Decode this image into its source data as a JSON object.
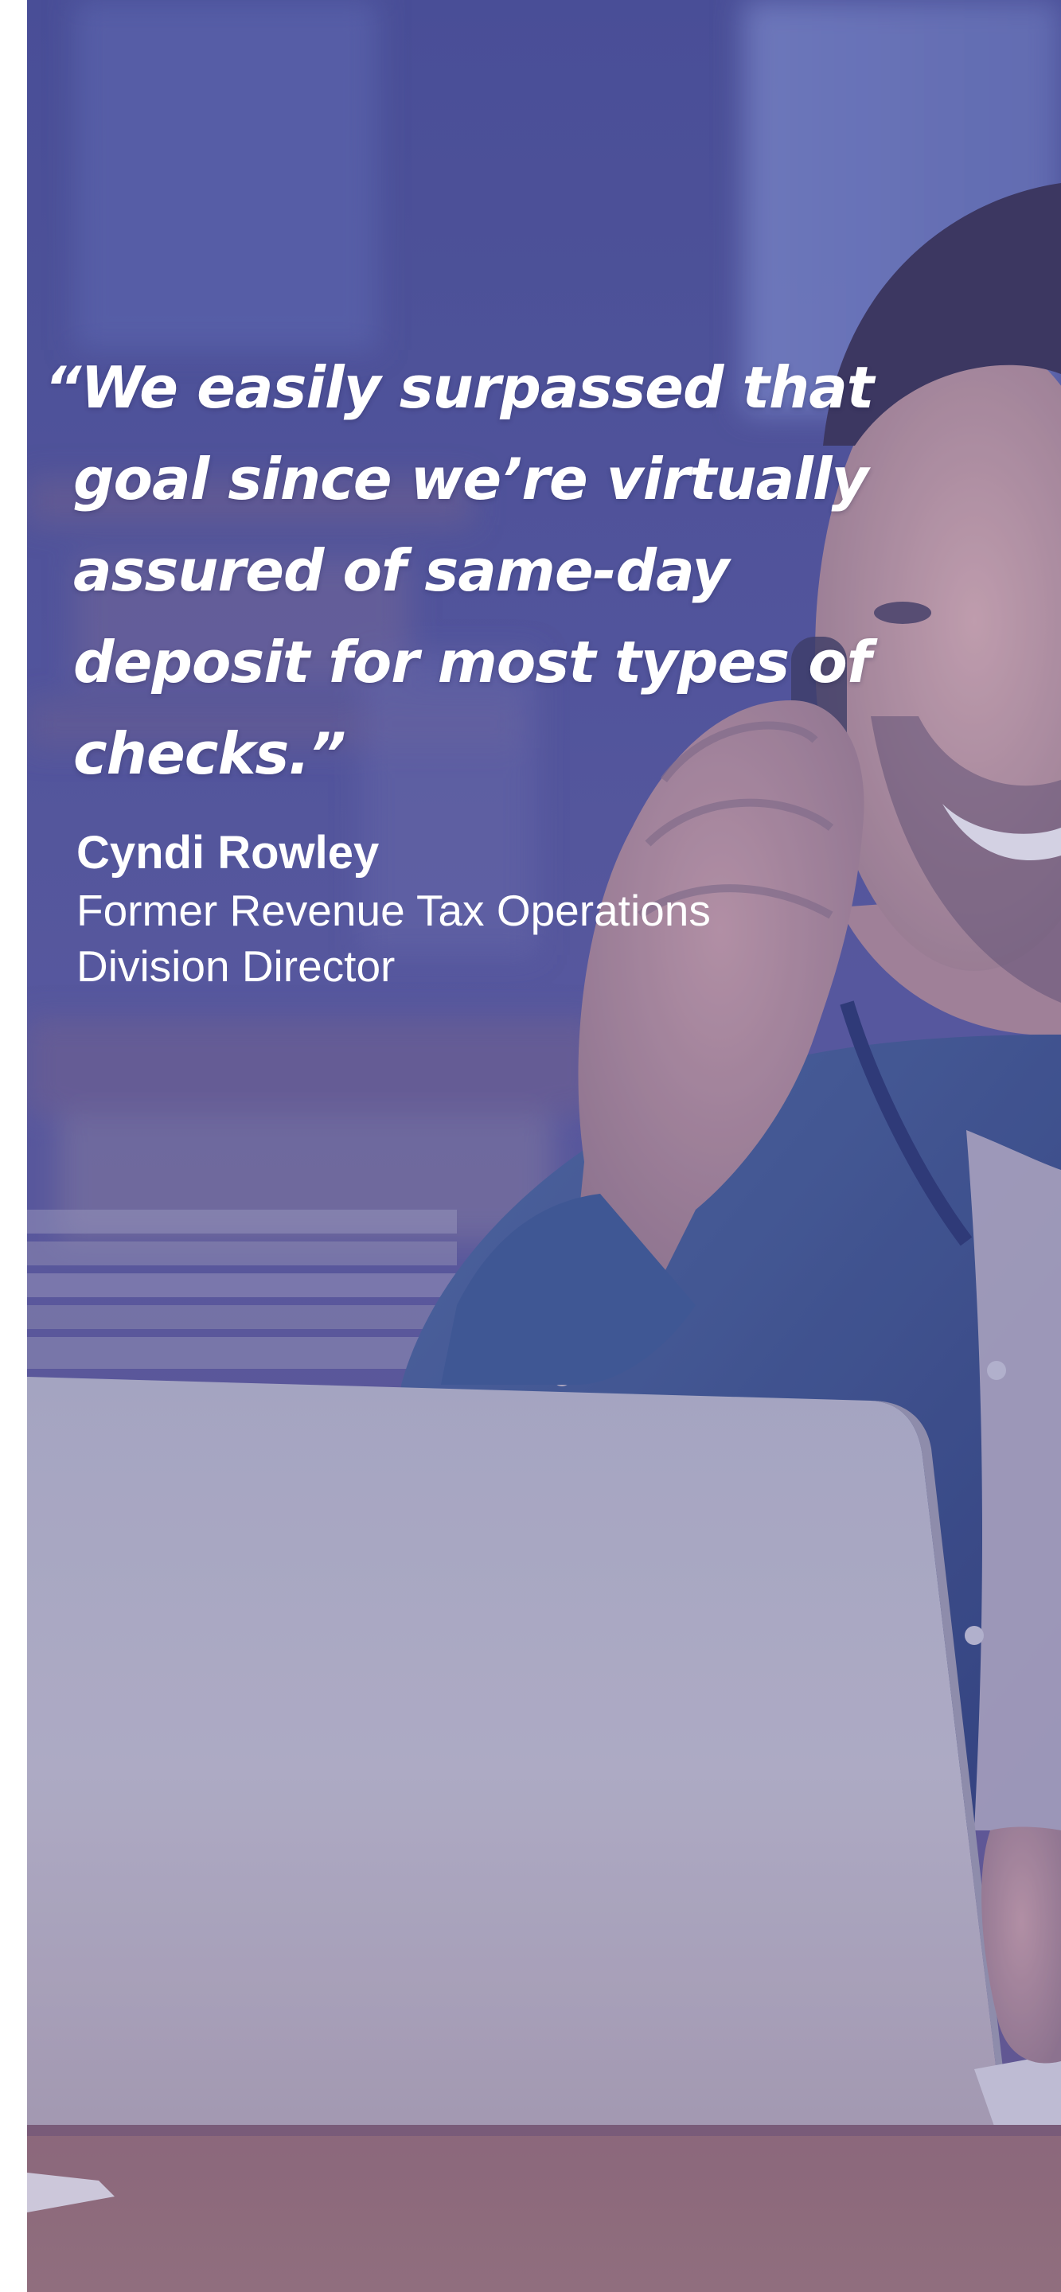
{
  "testimonial": {
    "quote": "“We easily surpassed that goal since we’re virtually assured of same-day deposit for most types of checks.”",
    "author_name": "Cyndi Rowley",
    "author_title_line1": "Former Revenue Tax Operations",
    "author_title_line2": "Division Director"
  },
  "photo": {
    "subject": "smiling-man-on-phone-with-laptop-photo",
    "overlay_color": "#4a4fa0",
    "desk_color": "#b07a5a",
    "laptop_color": "#c9c6cf",
    "shirt_color": "#3b5a8c"
  }
}
